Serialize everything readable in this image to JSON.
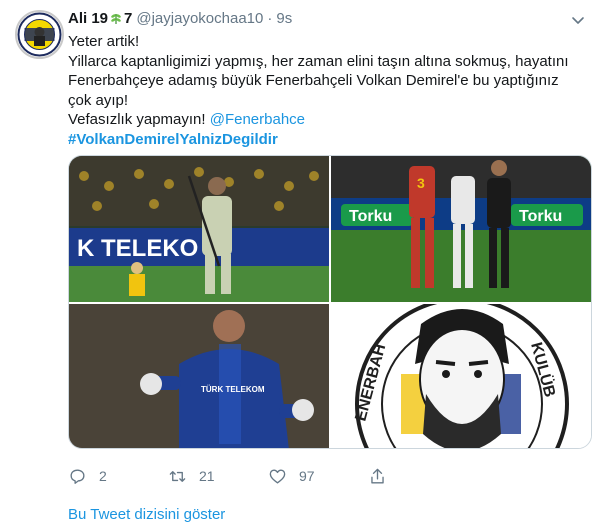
{
  "author": {
    "name": "Ali 19",
    "name_suffix": "7",
    "handle": "@jayjayokochaa10",
    "separator": "·",
    "time": "9s"
  },
  "tweet": {
    "line1": "Yeter artik!",
    "line2": "Yillarca kaptanligimizi yapmış, her zaman elini taşın altına sokmuş, hayatını",
    "line3": "Fenerbahçeye adamış büyük Fenerbahçeli Volkan Demirel'e bu yaptığınız",
    "line4": "çok ayıp!",
    "line5_prefix": " Vefasızlık yapmayın! ",
    "mention": "@Fenerbahce",
    "hashtag": "#VolkanDemirelYalnizDegildir"
  },
  "media": {
    "photo1_text": "K TELEKO",
    "photo2_text_a": "Torku",
    "photo2_text_b": "Torku",
    "photo2_jersey_num": "3",
    "photo3_text": "TÜRK TELEKOM",
    "photo4_text_left": "ENERBAH",
    "photo4_text_right": "KULÜB"
  },
  "actions": {
    "reply_count": "2",
    "retweet_count": "21",
    "like_count": "97"
  },
  "thread_link": "Bu Tweet dizisini göster",
  "colors": {
    "link": "#1b95e0",
    "muted": "#657786",
    "text": "#14171a"
  }
}
